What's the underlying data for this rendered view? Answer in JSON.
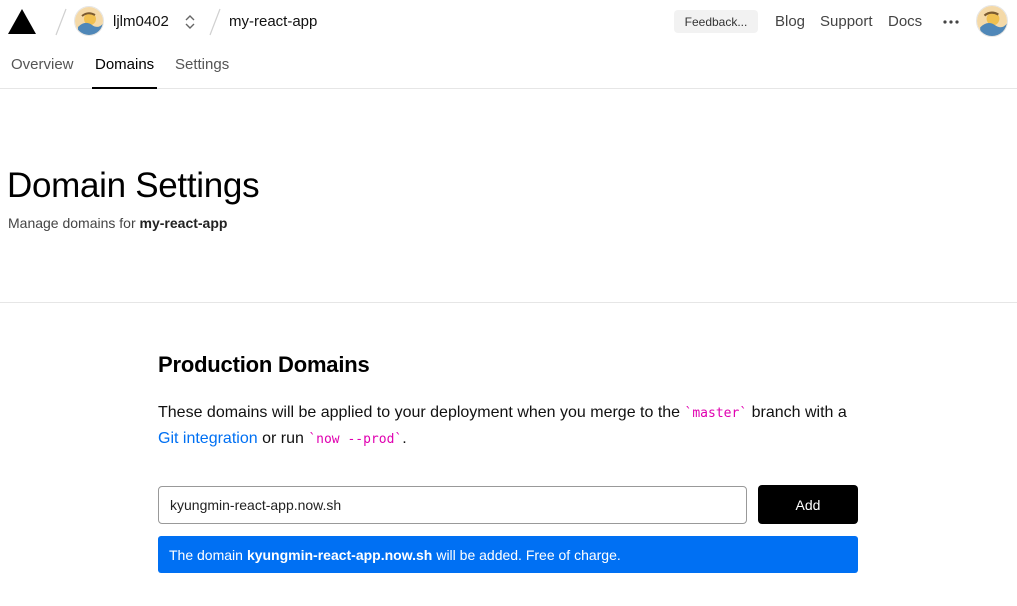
{
  "header": {
    "user": "ljlm0402",
    "project": "my-react-app",
    "feedback": "Feedback...",
    "nav": [
      "Blog",
      "Support",
      "Docs"
    ]
  },
  "tabs": [
    "Overview",
    "Domains",
    "Settings"
  ],
  "active_tab": "Domains",
  "page": {
    "title": "Domain Settings",
    "subtitle_prefix": "Manage domains for",
    "subtitle_project": "my-react-app"
  },
  "production": {
    "title": "Production Domains",
    "desc_1": "These domains will be applied to your deployment when you merge to the",
    "code_1": "`master`",
    "desc_2": "branch with a",
    "link": "Git integration",
    "desc_3": "or run",
    "code_2": "`now --prod`",
    "desc_4": ".",
    "input_value": "kyungmin-react-app.now.sh",
    "add_label": "Add",
    "notice_prefix": "The domain",
    "notice_domain": "kyungmin-react-app.now.sh",
    "notice_suffix": "will be added. Free of charge."
  },
  "colors": {
    "accent": "#0070f3",
    "code": "#e000b0",
    "button": "#000000"
  }
}
